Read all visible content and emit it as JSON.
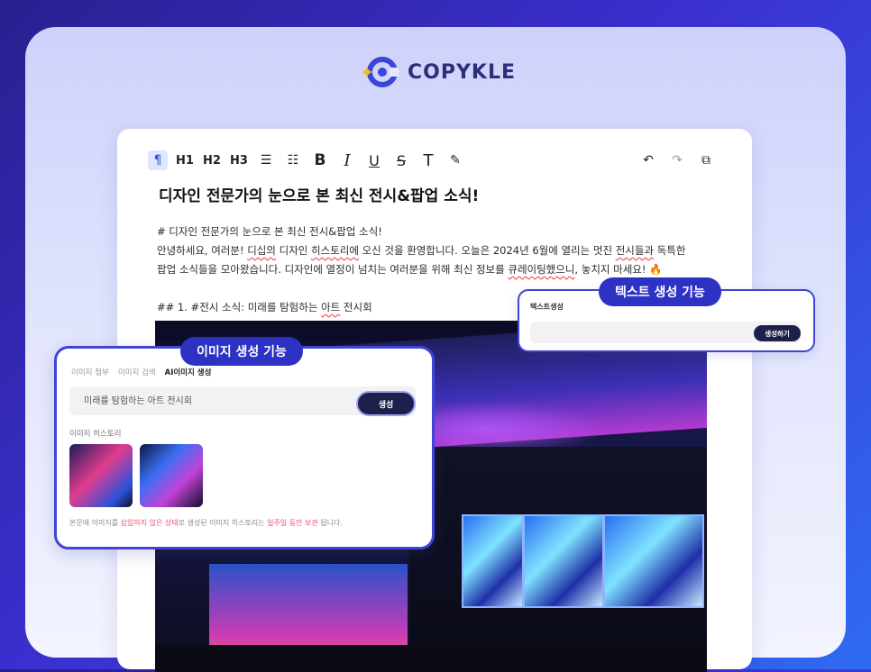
{
  "brand": {
    "name": "COPYKLE",
    "accent": "#2d2f7a"
  },
  "toolbar": {
    "items": [
      {
        "icon": "paragraph-icon",
        "label": "¶"
      },
      {
        "icon": "heading1-icon",
        "label": "H1"
      },
      {
        "icon": "heading2-icon",
        "label": "H2"
      },
      {
        "icon": "heading3-icon",
        "label": "H3"
      },
      {
        "icon": "bullet-list-icon",
        "label": "☰"
      },
      {
        "icon": "ordered-list-icon",
        "label": "☷"
      },
      {
        "icon": "bold-icon",
        "label": "B"
      },
      {
        "icon": "italic-icon",
        "label": "I"
      },
      {
        "icon": "underline-icon",
        "label": "U"
      },
      {
        "icon": "strikethrough-icon",
        "label": "S"
      },
      {
        "icon": "text-icon",
        "label": "T"
      },
      {
        "icon": "clear-format-icon",
        "label": "✎"
      }
    ],
    "right": [
      {
        "icon": "undo-icon",
        "label": "↶"
      },
      {
        "icon": "redo-icon",
        "label": "↷"
      },
      {
        "icon": "copy-icon",
        "label": "⧉"
      }
    ]
  },
  "document": {
    "title": "디자인 전문가의 눈으로 본 최신 전시&팝업 소식!",
    "line1": "# 디자인 전문가의 눈으로 본 최신 전시&팝업 소식!",
    "line2a": "안녕하세요, 여러분! ",
    "line2b": "디십의",
    "line2c": " 디자인 ",
    "line2d": "히스토리에",
    "line2e": " 오신 것을 환영합니다. 오늘은 2024년 6월에 열리는 멋진 ",
    "line2f": "전시들과",
    "line2g": " 독특한",
    "line3a": "팝업 소식들을 모아왔습니다. 디자인에 열정이 넘치는 여러분을 위해 최신 정보를 ",
    "line3b": "큐레이팅했으니",
    "line3c": ", 놓치지 마세요! 🔥",
    "line4a": "## 1. #전시 소식: 미래를 탐험하는 ",
    "line4b": "아트",
    "line4c": " 전시회"
  },
  "text_gen": {
    "pill": "텍스트 생성 기능",
    "label": "텍스트생성",
    "button": "생성하기"
  },
  "image_gen": {
    "pill": "이미지 생성 기능",
    "tabs": [
      "이미지 첨부",
      "이미지 검색",
      "AI이미지 생성"
    ],
    "search_value": "미래를 탐험하는 아트 전시회",
    "button": "생성",
    "history_label": "이미지 히스토리",
    "note_a": "본문에 이미지를 ",
    "note_b": "삽입하지 않은 상태",
    "note_c": "로 생성된 이미지 히스토리는 ",
    "note_d": "일주일 동안 보관",
    "note_e": " 됩니다."
  }
}
